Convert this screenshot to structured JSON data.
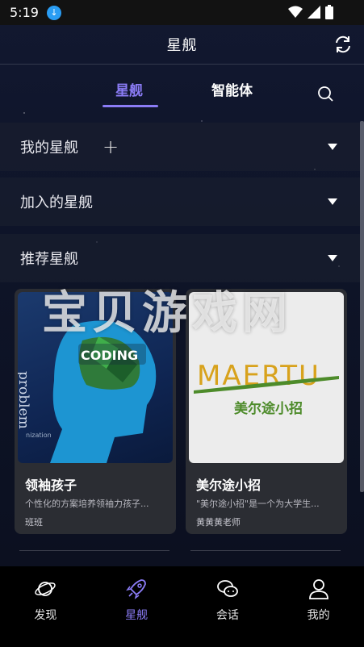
{
  "status_bar": {
    "time": "5:19"
  },
  "header": {
    "title": "星舰"
  },
  "tabs": [
    {
      "label": "星舰",
      "active": true
    },
    {
      "label": "智能体",
      "active": false
    }
  ],
  "sections": [
    {
      "label": "我的星舰"
    },
    {
      "label": "加入的星舰"
    },
    {
      "label": "推荐星舰"
    }
  ],
  "cards": [
    {
      "title": "领袖孩子",
      "description": "个性化的方案培养领袖力孩子...",
      "author": "班班",
      "image_text_main": "CODING",
      "image_text_side": "problem",
      "image_text_bottom": "nization"
    },
    {
      "title": "美尔途小招",
      "description": "\"美尔途小招\"是一个为大学生...",
      "author": "黄黄黄老师",
      "image_text_main": "MAERTU",
      "image_text_sub": "美尔途小招"
    }
  ],
  "watermark": "宝贝游戏网",
  "bottom_nav": [
    {
      "label": "发现",
      "icon": "planet-icon",
      "active": false
    },
    {
      "label": "星舰",
      "icon": "rocket-icon",
      "active": true
    },
    {
      "label": "会话",
      "icon": "chat-icon",
      "active": false
    },
    {
      "label": "我的",
      "icon": "person-icon",
      "active": false
    }
  ],
  "colors": {
    "accent": "#8b7cf6",
    "background": "#0c1020",
    "card": "#2b2d33"
  }
}
